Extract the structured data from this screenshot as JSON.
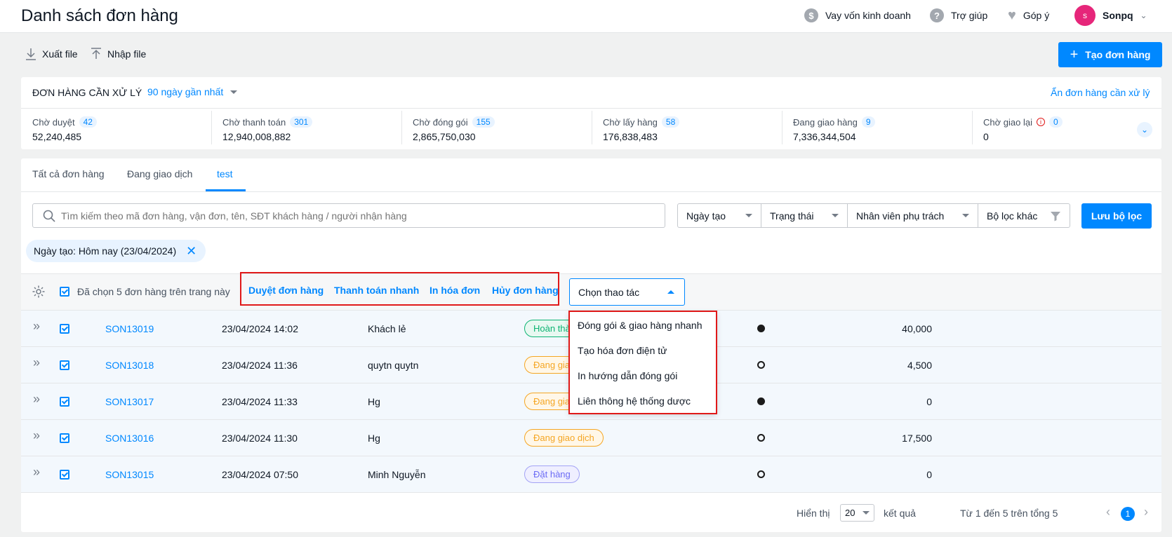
{
  "header": {
    "title": "Danh sách đơn hàng",
    "loan_label": "Vay vốn kinh doanh",
    "help_label": "Trợ giúp",
    "feedback_label": "Góp ý",
    "user_initial": "s",
    "user_name": "Sonpq"
  },
  "toolbar": {
    "export_label": "Xuất file",
    "import_label": "Nhập file",
    "create_label": "Tạo đơn hàng"
  },
  "pending": {
    "title": "ĐƠN HÀNG CẦN XỬ LÝ",
    "range": "90 ngày gần nhất",
    "hide_label": "Ẩn đơn hàng cần xử lý",
    "stats": [
      {
        "label": "Chờ duyệt",
        "count": "42",
        "value": "52,240,485"
      },
      {
        "label": "Chờ thanh toán",
        "count": "301",
        "value": "12,940,008,882"
      },
      {
        "label": "Chờ đóng gói",
        "count": "155",
        "value": "2,865,750,030"
      },
      {
        "label": "Chờ lấy hàng",
        "count": "58",
        "value": "176,838,483"
      },
      {
        "label": "Đang giao hàng",
        "count": "9",
        "value": "7,336,344,504"
      },
      {
        "label": "Chờ giao lại",
        "count": "0",
        "value": "0"
      }
    ]
  },
  "tabs": [
    "Tất cả đơn hàng",
    "Đang giao dịch",
    "test"
  ],
  "search": {
    "placeholder": "Tìm kiếm theo mã đơn hàng, vận đơn, tên, SĐT khách hàng / người nhận hàng"
  },
  "filters": {
    "created": "Ngày tạo",
    "status": "Trạng thái",
    "staff": "Nhân viên phụ trách",
    "other": "Bộ lọc khác",
    "save": "Lưu bộ lọc",
    "active_tag": "Ngày tạo: Hôm nay (23/04/2024)"
  },
  "bulk": {
    "selected_text": "Đã chọn 5 đơn hàng trên trang này",
    "approve": "Duyệt đơn hàng",
    "quick_pay": "Thanh toán nhanh",
    "print_invoice": "In hóa đơn",
    "cancel": "Hủy đơn hàng",
    "choose_action": "Chọn thao tác"
  },
  "dropdown": [
    "Đóng gói & giao hàng nhanh",
    "Tạo hóa đơn điện tử",
    "In hướng dẫn đóng gói",
    "Liên thông hệ thống dược"
  ],
  "orders": [
    {
      "code": "SON13019",
      "date": "23/04/2024 14:02",
      "customer": "Khách lẻ",
      "status": "Hoàn thà",
      "dot": "full",
      "amount": "40,000"
    },
    {
      "code": "SON13018",
      "date": "23/04/2024 11:36",
      "customer": "quytn quytn",
      "status": "Đang giao",
      "dot": "empty",
      "amount": "4,500"
    },
    {
      "code": "SON13017",
      "date": "23/04/2024 11:33",
      "customer": "Hg",
      "status": "Đang giao",
      "dot": "full",
      "amount": "0"
    },
    {
      "code": "SON13016",
      "date": "23/04/2024 11:30",
      "customer": "Hg",
      "status": "Đang giao dịch",
      "dot": "empty",
      "amount": "17,500"
    },
    {
      "code": "SON13015",
      "date": "23/04/2024 07:50",
      "customer": "Minh Nguyễn",
      "status": "Đặt hàng",
      "dot": "empty",
      "amount": "0"
    }
  ],
  "pagination": {
    "show_label": "Hiển thị",
    "page_size": "20",
    "results_label": "kết quả",
    "range_text": "Từ 1 đến 5 trên tổng 5",
    "current_page": "1"
  },
  "colors": {
    "primary": "#0088ff",
    "highlight": "#e01919",
    "success": "#0db473",
    "warning": "#f5a623",
    "violet": "#6c6cf5"
  }
}
